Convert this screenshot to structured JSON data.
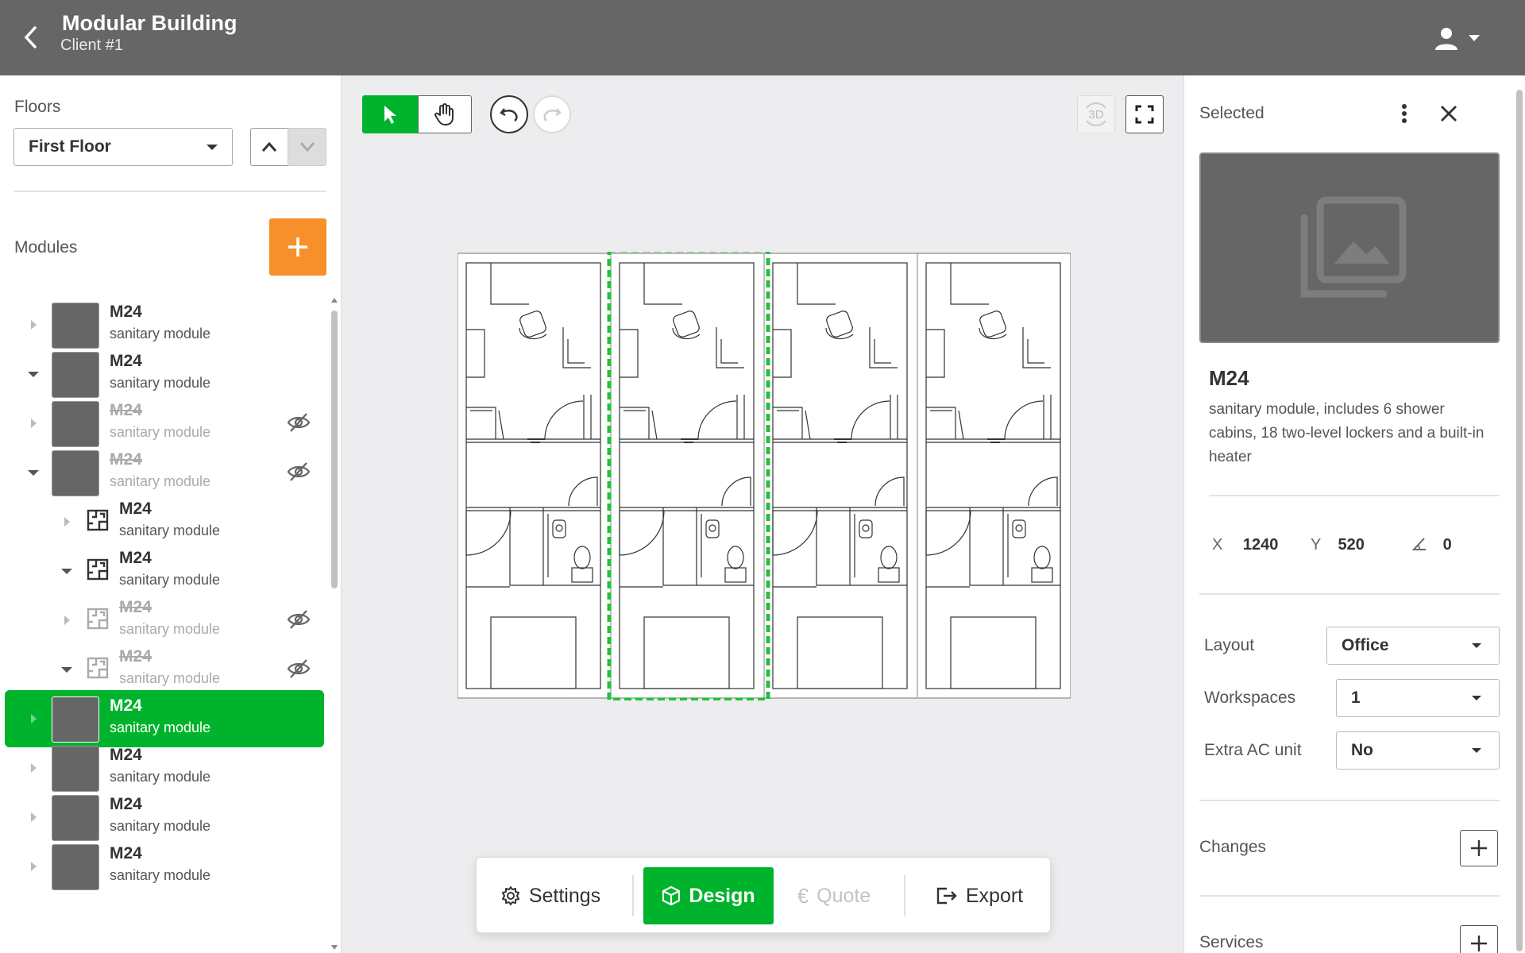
{
  "header": {
    "title": "Modular Building",
    "subtitle": "Client #1"
  },
  "sidebar": {
    "floors_label": "Floors",
    "floor_selected": "First Floor",
    "modules_label": "Modules",
    "modules": [
      {
        "name": "M24",
        "type": "sanitary module",
        "level": 0,
        "expanded": false,
        "hidden": false,
        "selected": false
      },
      {
        "name": "M24",
        "type": "sanitary module",
        "level": 0,
        "expanded": true,
        "hidden": false,
        "selected": false
      },
      {
        "name": "M24",
        "type": "sanitary module",
        "level": 0,
        "expanded": false,
        "hidden": true,
        "selected": false
      },
      {
        "name": "M24",
        "type": "sanitary module",
        "level": 0,
        "expanded": true,
        "hidden": true,
        "selected": false
      },
      {
        "name": "M24",
        "type": "sanitary module",
        "level": 1,
        "expanded": false,
        "hidden": false,
        "selected": false
      },
      {
        "name": "M24",
        "type": "sanitary module",
        "level": 1,
        "expanded": true,
        "hidden": false,
        "selected": false
      },
      {
        "name": "M24",
        "type": "sanitary module",
        "level": 1,
        "expanded": false,
        "hidden": true,
        "selected": false
      },
      {
        "name": "M24",
        "type": "sanitary module",
        "level": 1,
        "expanded": true,
        "hidden": true,
        "selected": false
      },
      {
        "name": "M24",
        "type": "sanitary module",
        "level": 0,
        "expanded": false,
        "hidden": false,
        "selected": true
      },
      {
        "name": "M24",
        "type": "sanitary module",
        "level": 0,
        "expanded": false,
        "hidden": false,
        "selected": false
      },
      {
        "name": "M24",
        "type": "sanitary module",
        "level": 0,
        "expanded": false,
        "hidden": false,
        "selected": false
      },
      {
        "name": "M24",
        "type": "sanitary module",
        "level": 0,
        "expanded": false,
        "hidden": false,
        "selected": false
      }
    ]
  },
  "toolbar": {
    "btn_3d_label": "3D"
  },
  "bottom_bar": {
    "settings": "Settings",
    "design": "Design",
    "quote": "Quote",
    "export": "Export"
  },
  "panel": {
    "title": "Selected",
    "module_name": "M24",
    "description": "sanitary module, includes 6 shower cabins, 18 two-level lockers and a built-in heater",
    "x_label": "X",
    "x_value": "1240",
    "y_label": "Y",
    "y_value": "520",
    "angle_value": "0",
    "layout_label": "Layout",
    "layout_value": "Office",
    "workspaces_label": "Workspaces",
    "workspaces_value": "1",
    "extra_ac_label": "Extra AC unit",
    "extra_ac_value": "No",
    "changes_label": "Changes",
    "services_label": "Services"
  },
  "colors": {
    "header": "#666666",
    "accent_green": "#00b32c",
    "accent_orange": "#f7902a",
    "selection_outline": "#22c13b"
  }
}
